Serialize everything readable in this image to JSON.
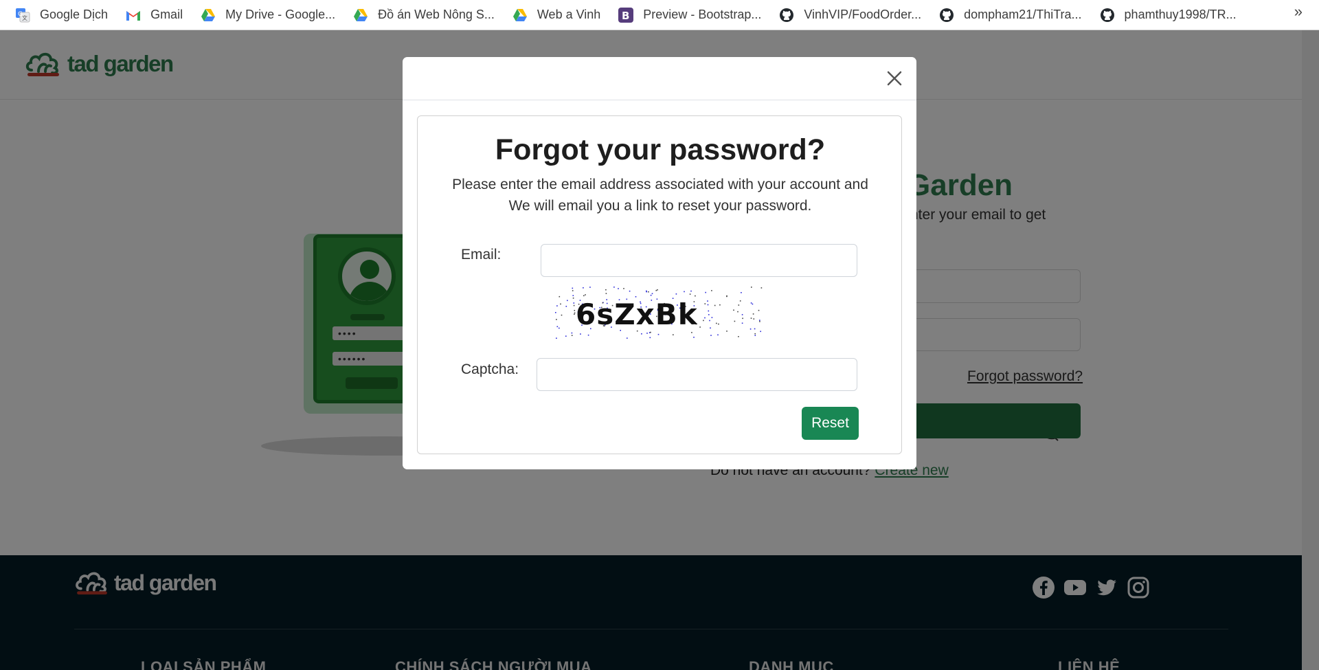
{
  "bookmarks": {
    "items": [
      {
        "label": "Google Dịch",
        "icon": "google-translate-icon"
      },
      {
        "label": "Gmail",
        "icon": "gmail-icon"
      },
      {
        "label": "My Drive - Google...",
        "icon": "google-drive-icon"
      },
      {
        "label": "Đồ án Web Nông S...",
        "icon": "google-drive-icon"
      },
      {
        "label": "Web a Vinh",
        "icon": "google-drive-icon"
      },
      {
        "label": "Preview - Bootstrap...",
        "icon": "bootstrap-icon"
      },
      {
        "label": "VinhVIP/FoodOrder...",
        "icon": "github-icon"
      },
      {
        "label": "dompham21/ThiTra...",
        "icon": "github-icon"
      },
      {
        "label": "phamthuy1998/TR...",
        "icon": "github-icon"
      }
    ],
    "more": "»"
  },
  "header": {
    "logo_text": "tad garden"
  },
  "auth": {
    "title_partial": "Garden",
    "subtitle_partial": "nter your email to get",
    "password_mask": "",
    "forgot_link": "Forgot password?",
    "signup_prompt": "Do not have an account?",
    "signup_link": "Create new"
  },
  "illustration": {
    "field1": "••••",
    "field2": "••••••"
  },
  "modal": {
    "title": "Forgot your password?",
    "description": "Please enter the email address associated with your account and We will email you a link to reset your password.",
    "email_label": "Email:",
    "email_value": "",
    "captcha_text": "6sZxBk",
    "captcha_label": "Captcha:",
    "captcha_value": "",
    "reset_label": "Reset"
  },
  "footer": {
    "logo_text": "tad garden",
    "social": [
      "facebook-icon",
      "youtube-icon",
      "twitter-icon",
      "instagram-icon"
    ],
    "columns": [
      "LOẠI SẢN PHẨM",
      "CHÍNH SÁCH NGƯỜI MUA",
      "DANH MỤC",
      "LIÊN HỆ"
    ]
  },
  "colors": {
    "brand_green": "#2e7d4f",
    "button_green": "#198754",
    "footer_bg": "#041d26"
  }
}
